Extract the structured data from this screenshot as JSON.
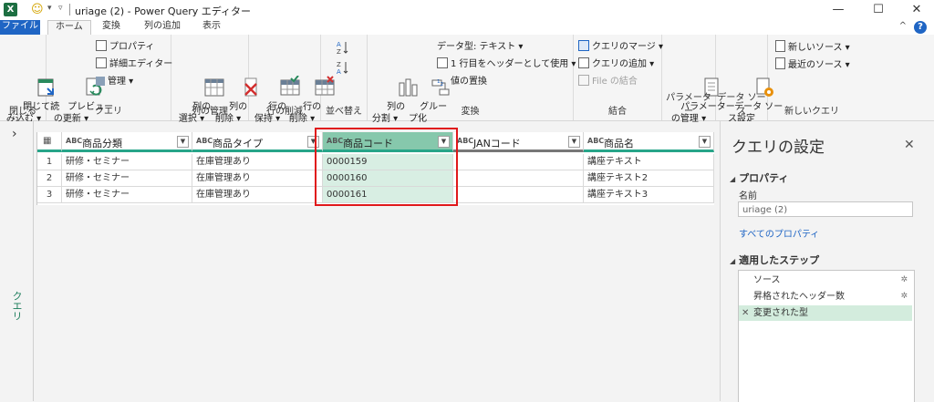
{
  "window": {
    "app_icon": "X",
    "title": "uriage (2) - Power Query エディター",
    "controls": [
      "—",
      "☐",
      "✕"
    ]
  },
  "tabs": [
    {
      "label": "ファイル"
    },
    {
      "label": "ホーム"
    },
    {
      "label": "変換"
    },
    {
      "label": "列の追加"
    },
    {
      "label": "表示"
    }
  ],
  "ribbon": {
    "close": {
      "btn": "閉じて読\nみ込む ▾",
      "label": "閉じる"
    },
    "query": {
      "preview": "プレビュー\nの更新 ▾",
      "properties": "プロパティ",
      "advanced": "詳細エディター",
      "manage": "管理 ▾",
      "label": "クエリ"
    },
    "columns": {
      "choose": "列の\n選択 ▾",
      "remove": "列の\n削除 ▾",
      "label": "列の管理"
    },
    "rows": {
      "keep": "行の\n保持 ▾",
      "remove": "行の\n削除 ▾",
      "label": "行の削減"
    },
    "sort": {
      "label": "並べ替え"
    },
    "transform": {
      "split": "列の\n分割 ▾",
      "group": "グルー\nプ化",
      "datatype": "データ型: テキスト ▾",
      "header": "1 行目をヘッダーとして使用 ▾",
      "replace": "値の置換",
      "label": "変換"
    },
    "combine": {
      "merge": "クエリのマージ ▾",
      "append": "クエリの追加 ▾",
      "files": "File の結合",
      "label": "結合"
    },
    "params": {
      "btn": "パラメーター\nの管理 ▾",
      "label": "パラメーター"
    },
    "source": {
      "btn": "データ ソー\nス設定",
      "label": "データ ソース"
    },
    "newquery": {
      "new": "新しいソース ▾",
      "recent": "最近のソース ▾",
      "label": "新しいクエリ"
    }
  },
  "left_pane": {
    "label": "クエリ"
  },
  "grid": {
    "columns": [
      {
        "type": "ABC",
        "name": "商品分類"
      },
      {
        "type": "ABC",
        "name": "商品タイプ"
      },
      {
        "type": "ABC",
        "name": "商品コード"
      },
      {
        "type": "ABC",
        "name": "JANコード"
      },
      {
        "type": "ABC",
        "name": "商品名"
      }
    ],
    "rows": [
      {
        "n": "1",
        "c": [
          "研修・セミナー",
          "在庫管理あり",
          "0000159",
          "",
          "講座テキスト"
        ]
      },
      {
        "n": "2",
        "c": [
          "研修・セミナー",
          "在庫管理あり",
          "0000160",
          "",
          "講座テキスト2"
        ]
      },
      {
        "n": "3",
        "c": [
          "研修・セミナー",
          "在庫管理あり",
          "0000161",
          "",
          "講座テキスト3"
        ]
      }
    ]
  },
  "settings": {
    "title": "クエリの設定",
    "properties_heading": "プロパティ",
    "name_label": "名前",
    "name_value": "uriage (2)",
    "all_properties": "すべてのプロパティ",
    "steps_heading": "適用したステップ",
    "steps": [
      {
        "label": "ソース"
      },
      {
        "label": "昇格されたヘッダー数"
      },
      {
        "label": "変更された型"
      }
    ]
  },
  "colors": {
    "accent": "#27a589",
    "file_tab": "#1f65c4",
    "highlight": "#e0181b"
  }
}
